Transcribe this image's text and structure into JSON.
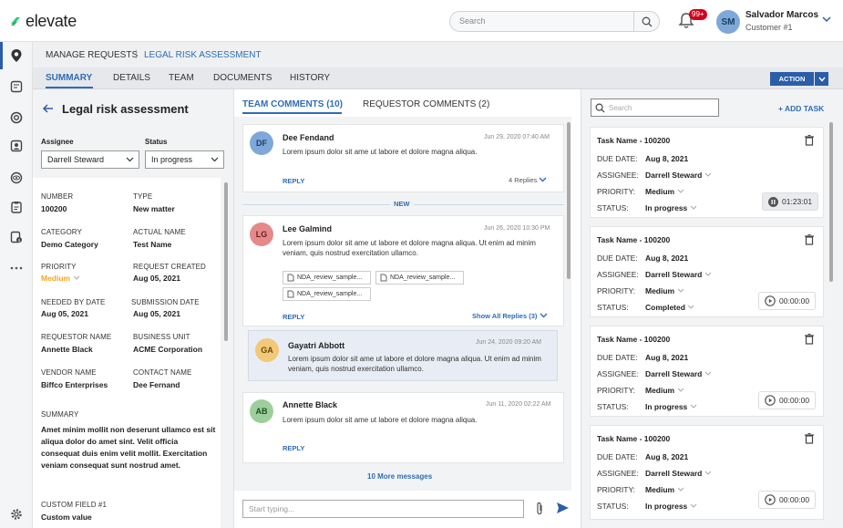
{
  "app": {
    "brand": "elevate",
    "search_placeholder": "Search",
    "badge": "99+"
  },
  "user": {
    "initials": "SM",
    "name": "Salvador Marcos",
    "role": "Customer #1"
  },
  "breadcrumb": {
    "root": "MANAGE REQUESTS",
    "sep": "|",
    "current": "LEGAL RISK ASSESSMENT"
  },
  "tabs": [
    "SUMMARY",
    "DETAILS",
    "TEAM",
    "DOCUMENTS",
    "HISTORY"
  ],
  "action": {
    "label": "ACTION"
  },
  "left": {
    "title": "Legal risk assessment",
    "assignee_label": "Assignee",
    "assignee_value": "Darrell Steward",
    "status_label": "Status",
    "status_value": "In progress",
    "fields": [
      {
        "label": "NUMBER",
        "value": "100200"
      },
      {
        "label": "TYPE",
        "value": "New matter"
      },
      {
        "label": "CATEGORY",
        "value": "Demo Category"
      },
      {
        "label": "ACTUAL NAME",
        "value": "Test Name"
      },
      {
        "label": "PRIORITY",
        "value": "Medium"
      },
      {
        "label": "REQUEST CREATED",
        "value": "Aug 05, 2021"
      },
      {
        "label": "NEEDED BY DATE",
        "value": "Aug 05, 2021"
      },
      {
        "label": "SUBMISSION DATE",
        "value": "Aug 05, 2021"
      },
      {
        "label": "REQUESTOR NAME",
        "value": "Annette Black"
      },
      {
        "label": "BUSINESS UNIT",
        "value": "ACME Corporation"
      },
      {
        "label": "VENDOR NAME",
        "value": "Biffco Enterprises"
      },
      {
        "label": "CONTACT NAME",
        "value": "Dee Fernand"
      }
    ],
    "summary_label": "SUMMARY",
    "summary_text": "Amet minim mollit non deserunt ullamco est sit aliqua dolor do amet sint. Velit officia consequat duis enim velit mollit. Exercitation veniam consequat sunt nostrud amet.",
    "custom_label": "CUSTOM FIELD #1",
    "custom_value": "Custom value"
  },
  "comments": {
    "tab_team": "TEAM COMMENTS (10)",
    "tab_requestor": "REQUESTOR COMMENTS (2)",
    "new_label": "NEW",
    "more": "10 More messages",
    "input_placeholder": "Start typing...",
    "reply": "REPLY",
    "items": [
      {
        "initials": "DF",
        "name": "Dee Fendand",
        "date": "Jun 29, 2020 07:40 AM",
        "text": "Lorem ipsum dolor sit ame ut labore et dolore magna aliqua.",
        "replies": "4 Replies"
      },
      {
        "initials": "LG",
        "name": "Lee Galmind",
        "date": "Jun 26, 2020 10:30 PM",
        "text": "Lorem ipsum dolor sit ame ut labore et dolore magna aliqua. Ut enim ad minim veniam, quis nostrud exercitation ullamco.",
        "replies": "Show All Replies (3)",
        "attachments": [
          "NDA_review_sample...",
          "NDA_review_sample...",
          "NDA_review_sample..."
        ]
      },
      {
        "initials": "GA",
        "name": "Gayatri Abbott",
        "date": "Jun 24, 2020 09:20 AM",
        "text": "Lorem ipsum dolor sit ame ut labore et dolore magna aliqua. Ut enim ad minim veniam, quis nostrud exercitation ullamco."
      },
      {
        "initials": "AB",
        "name": "Annette Black",
        "date": "Jun 11, 2020 02:22 AM",
        "text": "Lorem ipsum dolor sit ame ut labore et dolore magna aliqua."
      }
    ]
  },
  "tasks": {
    "search_placeholder": "Search",
    "add": "+ ADD TASK",
    "labels": {
      "due": "DUE DATE:",
      "assignee": "ASSIGNEE:",
      "priority": "PRIORITY:",
      "status": "STATUS:"
    },
    "items": [
      {
        "name": "Task Name - 100200",
        "due": "Aug 8, 2021",
        "assignee": "Darrell Steward",
        "priority": "Medium",
        "status": "In progress",
        "timer": "01:23:01"
      },
      {
        "name": "Task Name - 100200",
        "due": "Aug 8, 2021",
        "assignee": "Darrell Steward",
        "priority": "Medium",
        "status": "Completed",
        "timer": "00:00:00"
      },
      {
        "name": "Task Name - 100200",
        "due": "Aug 8, 2021",
        "assignee": "Darrell Steward",
        "priority": "Medium",
        "status": "In progress",
        "timer": "00:00:00"
      },
      {
        "name": "Task Name - 100200",
        "due": "Aug 8, 2021",
        "assignee": "Darrell Steward",
        "priority": "Medium",
        "status": "In progress",
        "timer": "00:00:00"
      }
    ]
  },
  "colors": {
    "accent": "#2f6db5",
    "priority": "#f5a623",
    "logo": "#2ecc71"
  }
}
